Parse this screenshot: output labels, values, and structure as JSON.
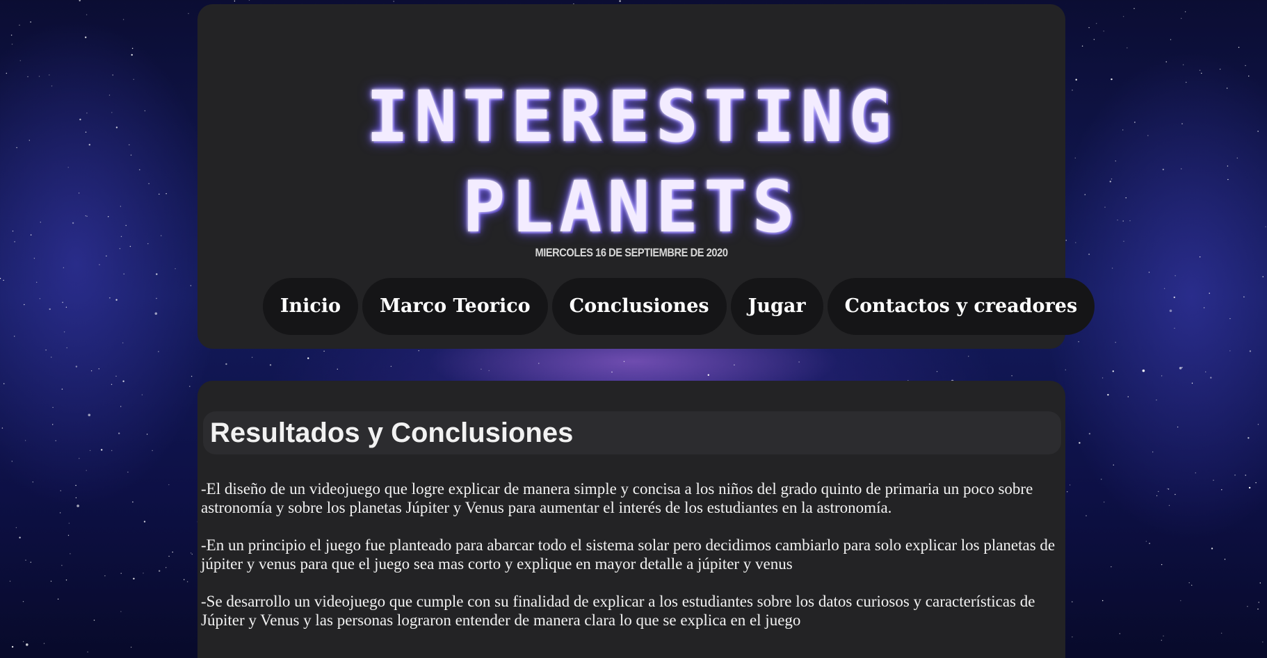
{
  "header": {
    "logo_line1": "INTERESTING",
    "logo_line2": "PLANETS",
    "date": "MIERCOLES 16 DE SEPTIEMBRE DE 2020"
  },
  "nav": {
    "items": [
      {
        "label": "Inicio"
      },
      {
        "label": "Marco Teorico"
      },
      {
        "label": "Conclusiones"
      },
      {
        "label": "Jugar"
      },
      {
        "label": "Contactos y creadores"
      }
    ]
  },
  "content": {
    "title": "Resultados y Conclusiones",
    "paragraphs": [
      "-El diseño de un videojuego que logre explicar de manera simple y concisa a los niños del grado quinto de primaria un poco sobre astronomía y sobre los planetas Júpiter y Venus para aumentar el interés de los estudiantes en la astronomía.",
      "-En un principio el juego fue planteado para abarcar todo el sistema solar pero decidimos cambiarlo para solo explicar los planetas de júpiter y venus para que el juego sea mas corto y explique en mayor detalle a júpiter y venus",
      "-Se desarrollo un videojuego que cumple con su finalidad de explicar a los estudiantes sobre los datos curiosos y características de Júpiter y Venus y las personas lograron entender de manera clara lo que se explica en el juego"
    ]
  },
  "colors": {
    "panel_bg": "#232325",
    "nav_pill_bg": "#151517",
    "logo_glow": "#9a86ff",
    "text": "#f2f2f2"
  }
}
